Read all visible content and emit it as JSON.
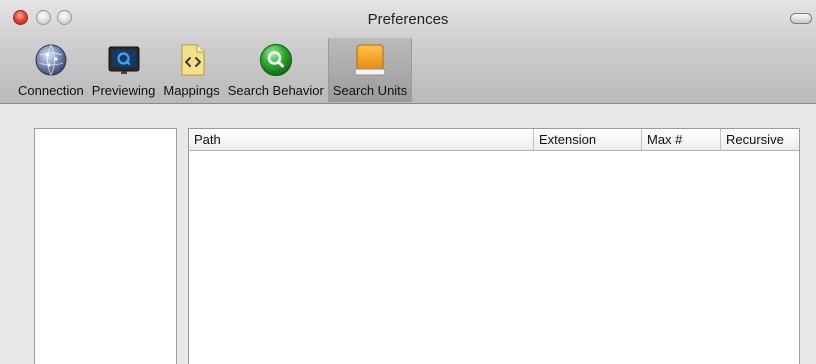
{
  "window": {
    "title": "Preferences"
  },
  "toolbar": {
    "items": [
      {
        "label": "Connection",
        "icon": "globe-icon",
        "selected": false
      },
      {
        "label": "Previewing",
        "icon": "monitor-icon",
        "selected": false
      },
      {
        "label": "Mappings",
        "icon": "code-document-icon",
        "selected": false
      },
      {
        "label": "Search Behavior",
        "icon": "magnifier-icon",
        "selected": false
      },
      {
        "label": "Search Units",
        "icon": "hard-drive-icon",
        "selected": true
      }
    ]
  },
  "table": {
    "columns": [
      "Path",
      "Extension",
      "Max #",
      "Recursive"
    ],
    "rows": []
  },
  "colors": {
    "close_button": "#e8473a",
    "search_behavior_icon": "#2fae2f",
    "search_units_icon": "#f2a21b",
    "selected_toolbar": "#b0b0b0"
  }
}
